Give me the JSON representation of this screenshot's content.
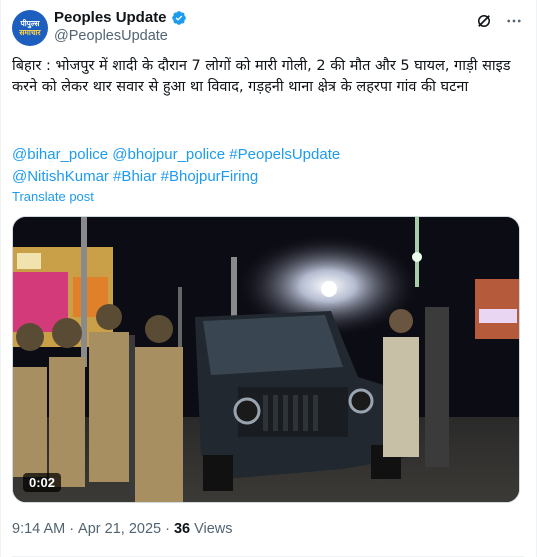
{
  "author": {
    "display_name": "Peoples Update",
    "handle": "@PeoplesUpdate",
    "avatar_line1": "पीपुल्स",
    "avatar_line2": "समाचार"
  },
  "tweet": {
    "text": "बिहार : भोजपुर में शादी के दौरान 7 लोगों को मारी गोली, 2 की मौत और 5 घायल, गाड़ी साइड करने को लेकर थार सवार से हुआ था विवाद, गड़हनी थाना क्षेत्र के लहरपा गांव की घटना",
    "hashtags_line1": [
      "@bihar_police",
      "@bhojpur_police",
      "#PeopelsUpdate"
    ],
    "hashtags_line2": [
      "@NitishKumar",
      "#Bhiar",
      "#BhojpurFiring"
    ],
    "translate_label": "Translate post"
  },
  "media": {
    "duration": "0:02"
  },
  "meta": {
    "time": "9:14 AM",
    "separator": "·",
    "date": "Apr 21, 2025",
    "views_count": "36",
    "views_label": "Views"
  },
  "icons": {
    "verified": "verified-badge-icon",
    "grok": "grok-icon",
    "more": "more-options-icon"
  },
  "colors": {
    "link": "#1d9bf0",
    "secondary": "#536471",
    "verified": "#1d9bf0"
  }
}
